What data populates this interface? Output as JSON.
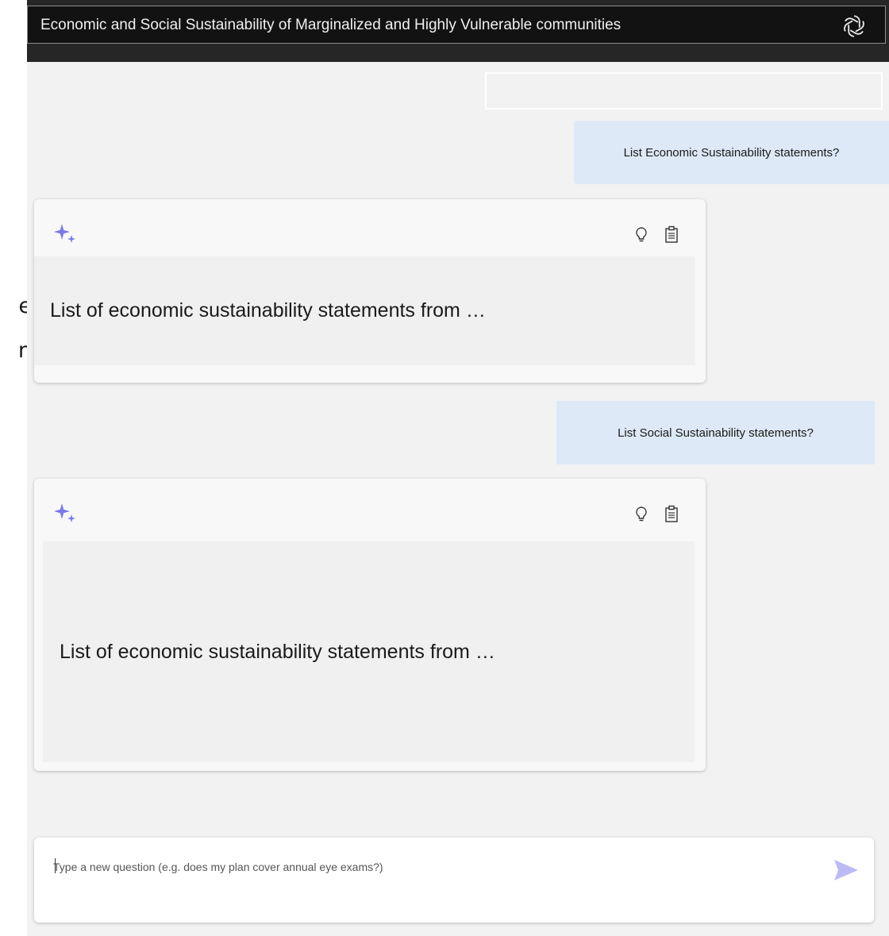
{
  "header": {
    "title": "Economic and Social Sustainability of Marginalized and Highly Vulnerable communities",
    "logo_icon": "openai-logo-icon"
  },
  "background_fragments": [
    "e",
    "n"
  ],
  "conversation": {
    "messages": [
      {
        "role": "user",
        "text": "List Economic Sustainability statements?"
      },
      {
        "role": "assistant",
        "text": "List of economic sustainability statements from …",
        "icons": [
          "sparkle-icon",
          "lightbulb-icon",
          "clipboard-icon"
        ]
      },
      {
        "role": "user",
        "text": "List Social  Sustainability statements?"
      },
      {
        "role": "assistant",
        "text": "List of economic sustainability statements from …",
        "icons": [
          "sparkle-icon",
          "lightbulb-icon",
          "clipboard-icon"
        ]
      }
    ]
  },
  "composer": {
    "placeholder": "Type a new question (e.g. does my plan cover annual eye exams?)",
    "value": "",
    "send_icon": "send-icon"
  },
  "colors": {
    "accent": "#7b79e8",
    "send": "#bcbaf5",
    "user_bubble": "#dde9f6",
    "header_bg": "#262626"
  }
}
